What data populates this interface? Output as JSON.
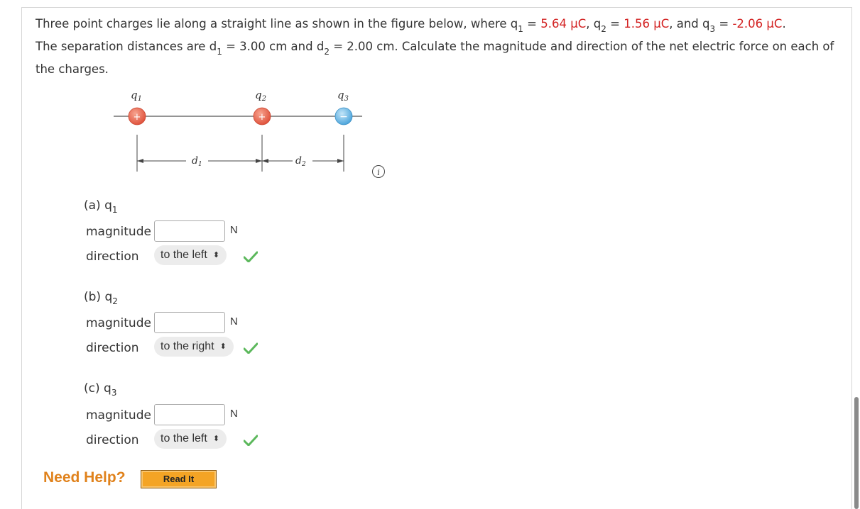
{
  "question": {
    "intro": "Three point charges lie along a straight line as shown in the figure below, where ",
    "q_symbol": "q",
    "q1_sub": "1",
    "q2_sub": "2",
    "q3_sub": "3",
    "eq": " = ",
    "q1_value": "5.64 µC",
    "sep1": ", ",
    "q2_value": "1.56 µC",
    "sep2": ", and ",
    "q3_value": "-2.06 µC",
    "period": ".",
    "line2a": "The separation distances are ",
    "d_symbol": "d",
    "d1_sub": "1",
    "d2_sub": "2",
    "d1_value": " = 3.00 cm",
    "and": " and ",
    "d2_value": " = 2.00 cm",
    "line2b": ". Calculate the magnitude and direction of the net electric force on each of the charges.",
    "highlight_color": "#d32222"
  },
  "figure": {
    "q1_label": "q",
    "q1_sub": "1",
    "q2_label": "q",
    "q2_sub": "2",
    "q3_label": "q",
    "q3_sub": "3",
    "plus": "+",
    "minus": "−",
    "d1_label": "d",
    "d1_sub": "1",
    "d2_label": "d",
    "d2_sub": "2",
    "positive_color": "#e8624d",
    "negative_color": "#6cb8e6"
  },
  "info_icon": "i",
  "parts": [
    {
      "label_prefix": "(a) q",
      "label_sub": "1",
      "magnitude_label": "magnitude",
      "magnitude_value": "",
      "unit": "N",
      "direction_label": "direction",
      "direction_value": "to the left",
      "correct": true
    },
    {
      "label_prefix": "(b) q",
      "label_sub": "2",
      "magnitude_label": "magnitude",
      "magnitude_value": "",
      "unit": "N",
      "direction_label": "direction",
      "direction_value": "to the right",
      "correct": true
    },
    {
      "label_prefix": "(c) q",
      "label_sub": "3",
      "magnitude_label": "magnitude",
      "magnitude_value": "",
      "unit": "N",
      "direction_label": "direction",
      "direction_value": "to the left",
      "correct": true
    }
  ],
  "help": {
    "need_help": "Need Help?",
    "read_it": "Read It",
    "need_help_color": "#e0821c",
    "button_color": "#f4a425"
  },
  "check_color": "#5cb85c"
}
